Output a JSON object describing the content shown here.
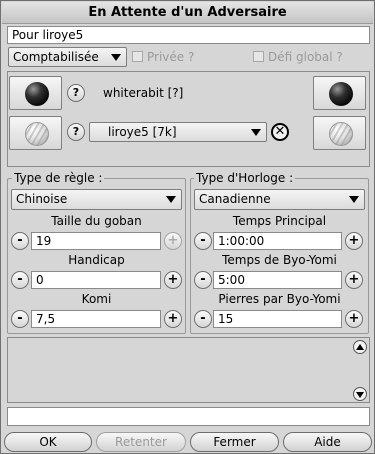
{
  "window": {
    "title": "En Attente d'un Adversaire"
  },
  "top": {
    "game_name": "Pour liroye5",
    "rating_mode": "Comptabilisée",
    "private_label": "Privée ?",
    "global_challenge_label": "Défi global ?"
  },
  "players": {
    "black_name": "whiterabit [?]",
    "white_name": "liroye5 [7k]",
    "question_mark": "?",
    "remove_glyph": "✕"
  },
  "rules": {
    "group_label": "Type de règle :",
    "rule_type": "Chinoise",
    "board_size_label": "Taille du goban",
    "board_size": "19",
    "handicap_label": "Handicap",
    "handicap": "0",
    "komi_label": "Komi",
    "komi": "7,5"
  },
  "clock": {
    "group_label": "Type d'Horloge :",
    "clock_type": "Canadienne",
    "main_time_label": "Temps Principal",
    "main_time": "1:00:00",
    "byoyomi_time_label": "Temps de Byo-Yomi",
    "byoyomi_time": "5:00",
    "stones_label": "Pierres par Byo-Yomi",
    "stones": "15"
  },
  "stepper": {
    "minus": "-",
    "plus": "+"
  },
  "chat": {
    "input_value": ""
  },
  "buttons": {
    "ok": "OK",
    "retry": "Retenter",
    "close": "Fermer",
    "help": "Aide"
  }
}
